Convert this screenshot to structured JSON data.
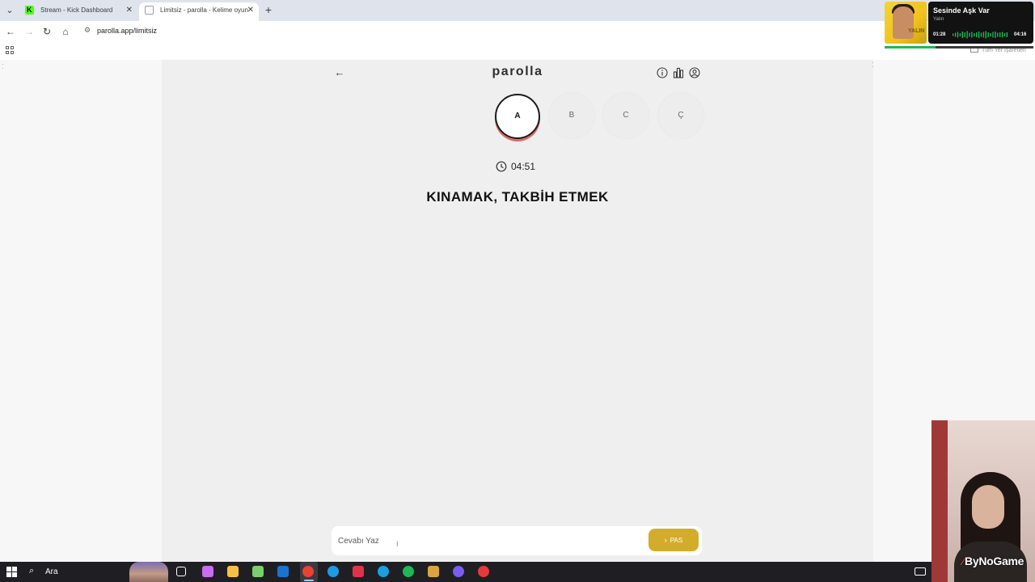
{
  "browser": {
    "tabs": [
      {
        "title": "Stream - Kick Dashboard",
        "active": false,
        "favicon": "kick-icon"
      },
      {
        "title": "Limitsiz - parolla - Kelime oyun",
        "active": true,
        "favicon": "parolla-icon"
      }
    ],
    "url": "parolla.app/limitsiz",
    "bookmarks_right": "Tüm Yer İşaretleri"
  },
  "app": {
    "logo": "parolla",
    "letters": [
      {
        "letter": "A",
        "state": "active"
      },
      {
        "letter": "B",
        "state": "idle"
      },
      {
        "letter": "C",
        "state": "idle"
      },
      {
        "letter": "Ç",
        "state": "idle"
      }
    ],
    "timer": "04:51",
    "question": "KINAMAK, TAKBİH ETMEK",
    "answer_placeholder": "Cevabı Yaz",
    "answer_value": "",
    "pass_label": "PAS",
    "colors": {
      "accent": "#d4ac2b",
      "active_ring": "#e06a6a",
      "panel": "#efefef"
    }
  },
  "now_playing": {
    "title": "Sesinde Aşk Var",
    "artist": "Yalın",
    "cover_text": "YALIN",
    "elapsed": "01:28",
    "duration": "04:16",
    "progress": 0.34
  },
  "overlay": {
    "watermark": "ByNoGame"
  },
  "taskbar": {
    "search_label": "Ara",
    "pinned": [
      {
        "name": "task-view-icon",
        "color": "#ffffff"
      },
      {
        "name": "copilot-icon",
        "color": "#c86cf0"
      },
      {
        "name": "file-explorer-icon",
        "color": "#f6c142"
      },
      {
        "name": "store-icon",
        "color": "#7ad06a"
      },
      {
        "name": "outlook-icon",
        "color": "#1a73d0"
      },
      {
        "name": "chrome-icon",
        "color": "#e94235"
      },
      {
        "name": "edge-icon",
        "color": "#1c9be6"
      },
      {
        "name": "valorant-icon",
        "color": "#e0334a"
      },
      {
        "name": "skype-icon",
        "color": "#1aa0e0"
      },
      {
        "name": "spotify-icon",
        "color": "#1db954"
      },
      {
        "name": "photos-icon",
        "color": "#d9a441"
      },
      {
        "name": "discord-icon",
        "color": "#7b5cf0"
      },
      {
        "name": "riot-client-icon",
        "color": "#e63a3a"
      }
    ]
  }
}
